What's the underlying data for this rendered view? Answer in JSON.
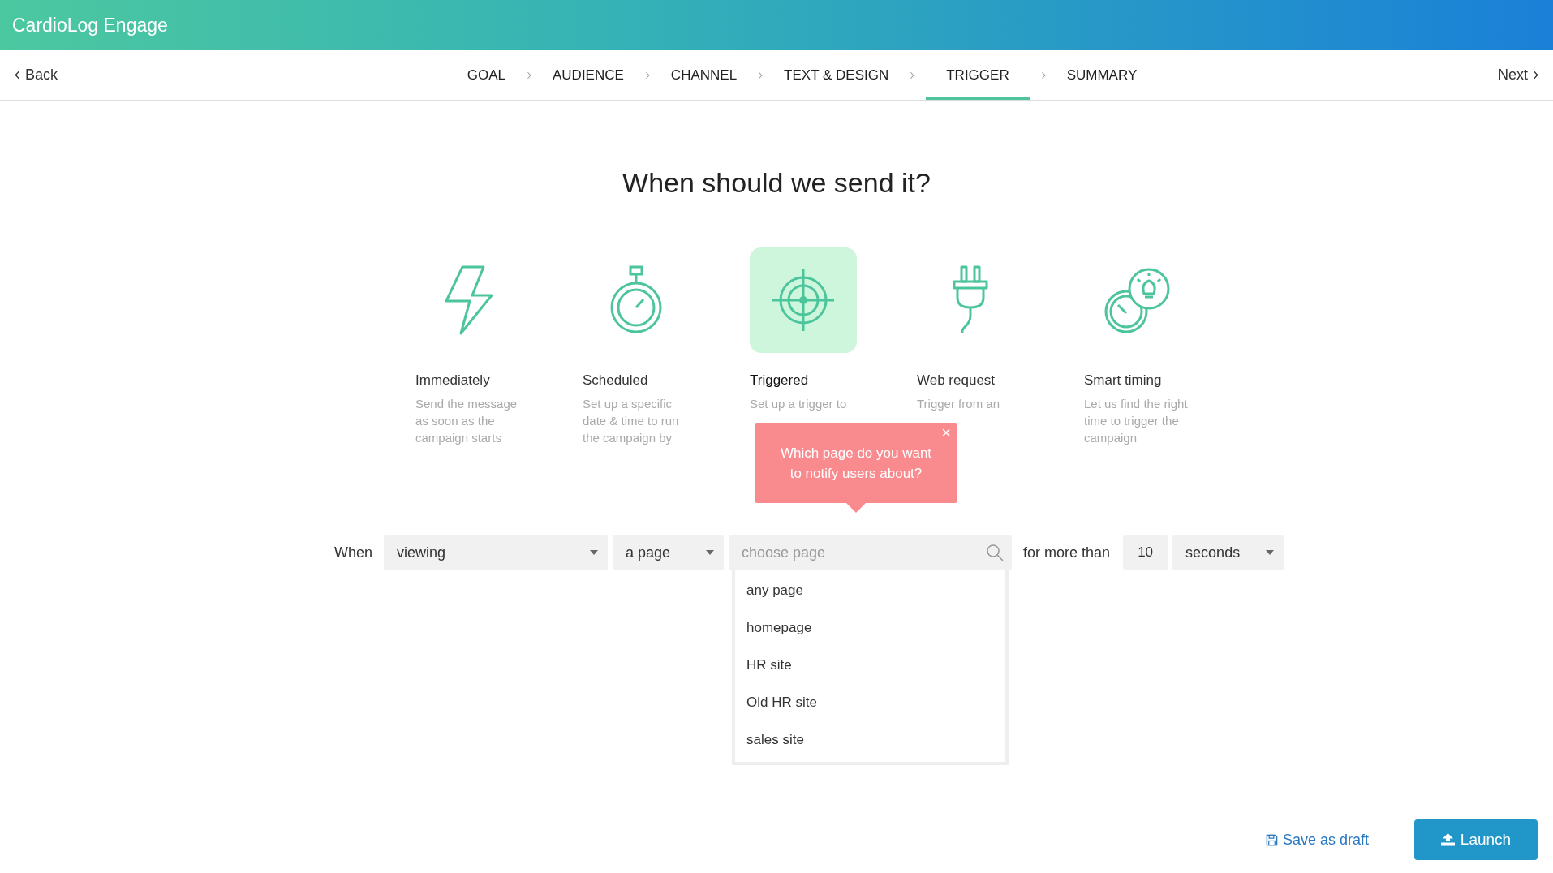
{
  "app": {
    "title": "CardioLog Engage"
  },
  "nav": {
    "back": "Back",
    "next": "Next",
    "steps": [
      {
        "label": "GOAL",
        "selected": false
      },
      {
        "label": "AUDIENCE",
        "selected": false
      },
      {
        "label": "CHANNEL",
        "selected": false
      },
      {
        "label": "TEXT & DESIGN",
        "selected": false
      },
      {
        "label": "TRIGGER",
        "selected": true
      },
      {
        "label": "SUMMARY",
        "selected": false
      }
    ]
  },
  "heading": "When should we send it?",
  "options": [
    {
      "kind": "bolt",
      "label": "Immediately",
      "description": "Send the message as soon as the campaign starts",
      "selected": false
    },
    {
      "kind": "stopwatch",
      "label": "Scheduled",
      "description": "Set up a specific date & time to run the campaign by",
      "selected": false
    },
    {
      "kind": "target",
      "label": "Triggered",
      "description": "Set up a trigger to",
      "selected": true
    },
    {
      "kind": "plug",
      "label": "Web request",
      "description": "Trigger from an",
      "selected": false
    },
    {
      "kind": "smart",
      "label": "Smart timing",
      "description": "Let us find the right time to trigger the campaign",
      "selected": false
    }
  ],
  "tooltip": {
    "text": "Which page do you want to notify users about?",
    "close": "×"
  },
  "rule": {
    "when": "When",
    "action": "viewing",
    "target": "a page",
    "page_field": {
      "placeholder": "choose page"
    },
    "duration_label": "for more than",
    "amount": "10",
    "unit": "seconds",
    "page_options": [
      "any page",
      "homepage",
      "HR site",
      "Old HR site",
      "sales site"
    ]
  },
  "footer": {
    "save": "Save as draft",
    "launch": "Launch"
  }
}
